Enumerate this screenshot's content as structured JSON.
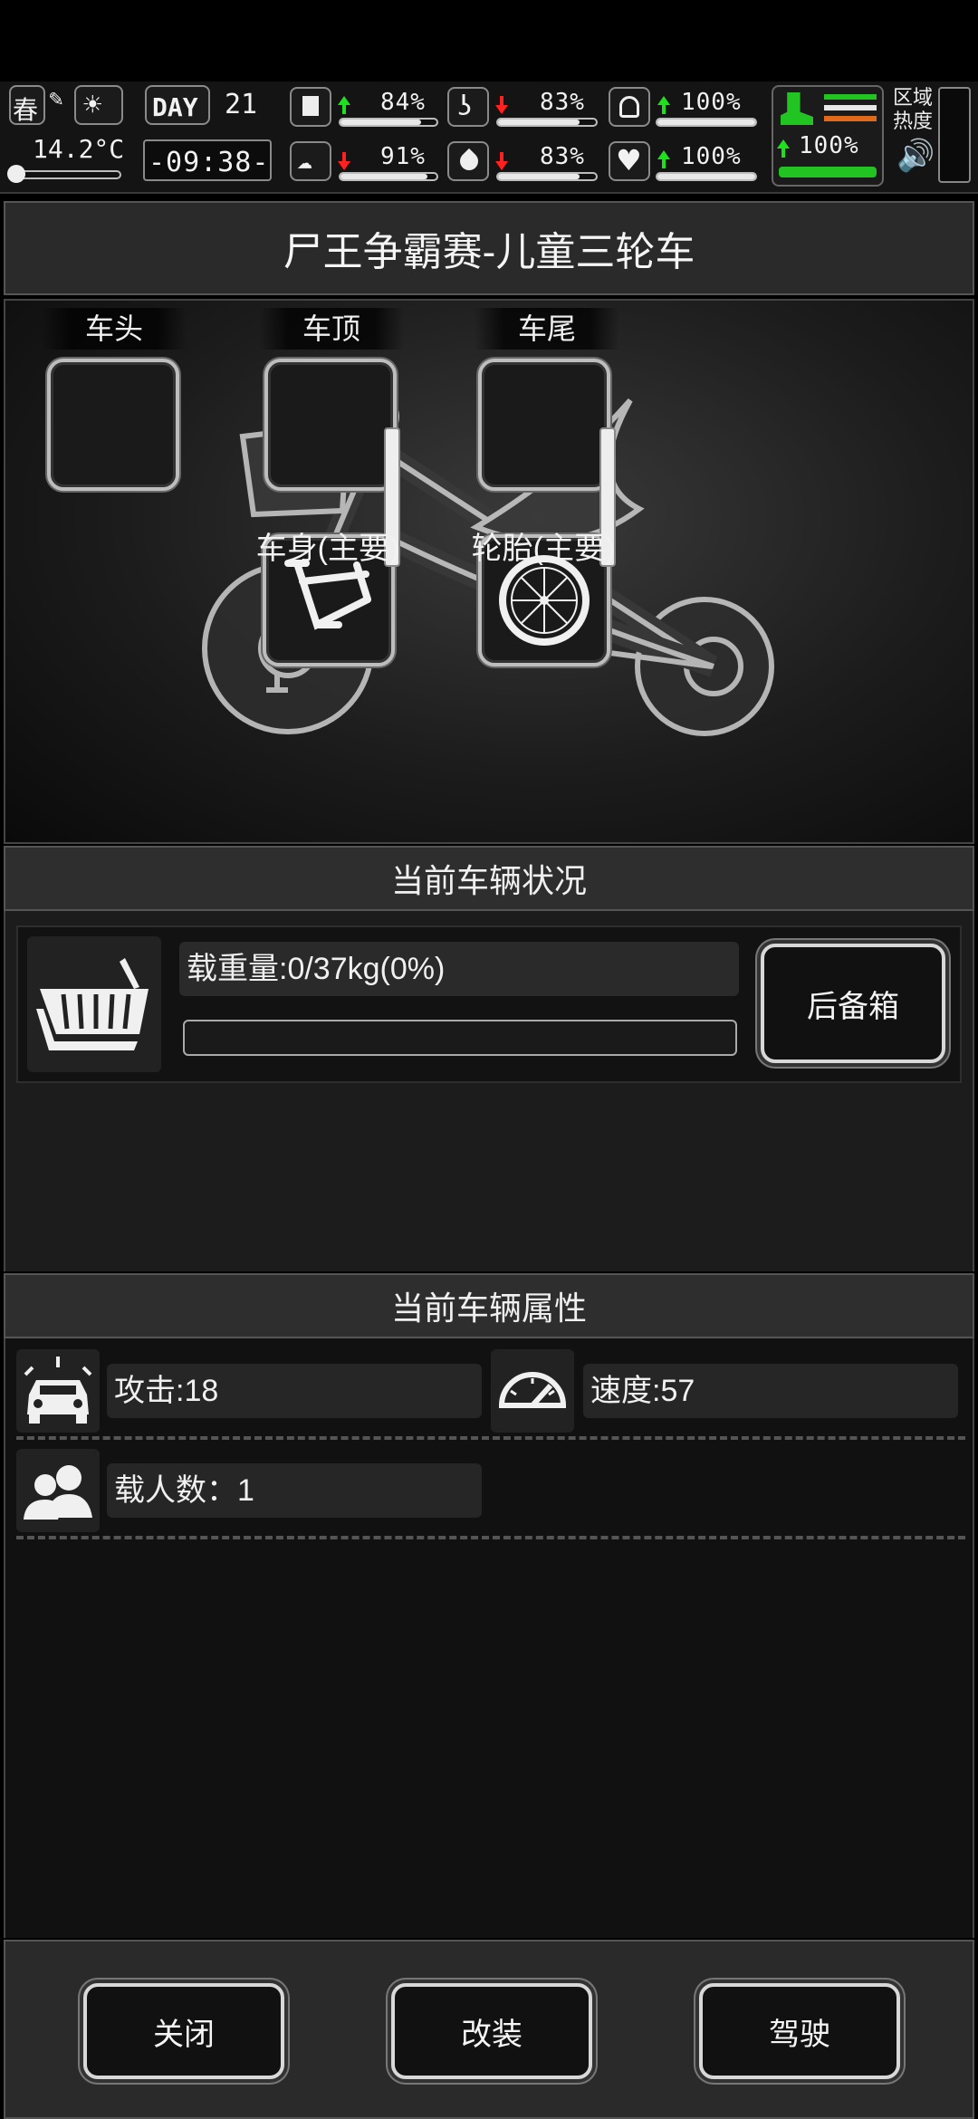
{
  "status_bar": {
    "season": "春",
    "temperature": "14.2°C",
    "day_label": "DAY",
    "day_number": "21",
    "time": "-09:38-",
    "stats": [
      {
        "name": "medical",
        "value": "84%",
        "trend": "up",
        "level": 0.84
      },
      {
        "name": "stomach",
        "value": "83%",
        "trend": "down",
        "level": 0.83
      },
      {
        "name": "stamina",
        "value": "100%",
        "trend": "up",
        "level": 1.0
      },
      {
        "name": "mind",
        "value": "91%",
        "trend": "down",
        "level": 0.91
      },
      {
        "name": "water",
        "value": "83%",
        "trend": "down",
        "level": 0.83
      },
      {
        "name": "health",
        "value": "100%",
        "trend": "up",
        "level": 1.0
      }
    ],
    "move": {
      "value": "100%",
      "trend": "up",
      "level": 1.0
    },
    "region_heat_label": "区域热度"
  },
  "title": "尸王争霸赛-儿童三轮车",
  "slots": {
    "front": "车头",
    "top": "车顶",
    "rear": "车尾",
    "body": "车身(主要)",
    "tire": "轮胎(主要)"
  },
  "vehicle_status": {
    "header": "当前车辆状况",
    "load_text": "载重量:0/37kg(0%)",
    "load_fraction": 0,
    "trunk_button": "后备箱"
  },
  "vehicle_attributes": {
    "header": "当前车辆属性",
    "attack": "攻击:18",
    "speed": "速度:57",
    "passengers": "载人数：1"
  },
  "footer": {
    "close": "关闭",
    "modify": "改装",
    "drive": "驾驶"
  },
  "colors": {
    "up_arrow": "#1ee11e",
    "down_arrow": "#ff2020",
    "move_accent": "#22c422",
    "heat_orange": "#e06a1c"
  }
}
